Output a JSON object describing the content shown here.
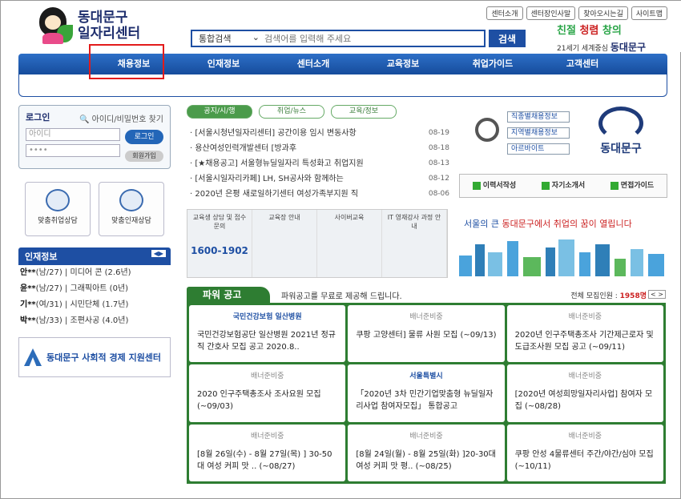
{
  "header": {
    "logo_line1": "동대문구",
    "logo_line2": "일자리센터",
    "search_category": "통합검색",
    "search_placeholder": "검색어를 입력해 주세요",
    "search_button": "검색",
    "top_links": [
      "센터소개",
      "센터장인사말",
      "찾아오시는길",
      "사이트맵"
    ],
    "slogan_a": "친절",
    "slogan_b": "청렴",
    "slogan_c": "창의",
    "slogan_sub": "21세기 세계중심",
    "slogan_name": "동대문구"
  },
  "nav": [
    "채용정보",
    "인재정보",
    "센터소개",
    "교육정보",
    "취업가이드",
    "고객센터"
  ],
  "login": {
    "title": "로그인",
    "find": "아이디/비밀번호 찾기",
    "id_placeholder": "아이디",
    "pw_value": "••••",
    "login_button": "로그인",
    "join_button": "회원가입"
  },
  "quick": [
    "맞춤취업상담",
    "맞춤인재상담"
  ],
  "talent": {
    "title": "인재정보",
    "rows": [
      {
        "name": "안**",
        "info": "(남/27) | 미디어 콘 (2.6년)"
      },
      {
        "name": "윤**",
        "info": "(남/27) | 그래픽아트 (0년)"
      },
      {
        "name": "기**",
        "info": "(여/31) | 시민단체 (1.7년)"
      },
      {
        "name": "박**",
        "info": "(남/33) | 조편사공 (4.0년)"
      }
    ]
  },
  "social_center": "동대문구 사회적 경제 지원센터",
  "tabs": [
    "공지/시/행",
    "취업/뉴스",
    "교육/정보"
  ],
  "news": [
    {
      "title": "[서울시청년일자리센터] 공간이용 임시 변동사항",
      "date": "08-19"
    },
    {
      "title": "용산여성인력개발센터 [방과후",
      "date": "08-18"
    },
    {
      "title": "[★채용공고] 서울형뉴딜일자리 특성화고 취업지원",
      "date": "08-13"
    },
    {
      "title": "[서울시일자리카페] LH, SH공사와 함께하는",
      "date": "08-12"
    },
    {
      "title": "2020년 은평 새로일하기센터 여성가족부지원 직",
      "date": "08-06"
    }
  ],
  "banner_center": {
    "c1_title": "교육생 상담 및 접수문의",
    "phone": "1600-1902",
    "c2_title": "교육장 안내",
    "c3_title": "사이버교육",
    "c4_title": "IT 영재강사 과정 안내"
  },
  "right_links": [
    "직종별채용정보",
    "지역별채용정보",
    "아르바이트"
  ],
  "seal_name": "동대문구",
  "guide": [
    "이력서작성",
    "자기소개서",
    "면접가이드"
  ],
  "tagline_a": "서울의 큰 ",
  "tagline_b": "동대문구에서 취업의 꿈이 열립니다",
  "power": {
    "title": "파워 공고",
    "desc": "파워공고를 무료로 제공해 드립니다.",
    "count_label": "전체 모집인원 : ",
    "count_value": "1958명",
    "nav": "< >",
    "cards": [
      {
        "logo": "국민건강보험 일산병원",
        "title": "국민건강보험공단 일산병원 2021년 정규직 간호사 모집 공고 2020.8.."
      },
      {
        "logo": "배너준비중",
        "title": "쿠팡 고양센터] 물류 사원 모집 (~09/13)"
      },
      {
        "logo": "배너준비중",
        "title": "2020년 인구주택총조사 기간제근로자 및 도급조사원 모집 공고 (~09/11)"
      },
      {
        "logo": "배너준비중",
        "title": "2020 인구주택총조사 조사요원 모집 (~09/03)"
      },
      {
        "logo": "서울특별시",
        "title": "「2020년 3차 민간기업맞춤형 뉴딜일자리사업 참여자모집」 통합공고"
      },
      {
        "logo": "배너준비중",
        "title": "[2020년 여성희망일자리사업] 참여자 모집 (~08/28)"
      },
      {
        "logo": "배너준비중",
        "title": "[8월 26일(수) - 8월 27일(목) ] 30-50대 여성 커피 맛 .. (~08/27)"
      },
      {
        "logo": "배너준비중",
        "title": "[8월 24일(월) - 8월 25일(화) ]20-30대 여성 커피 맛 평.. (~08/25)"
      },
      {
        "logo": "배너준비중",
        "title": "쿠팡 안성 4물류센터 주간/야간/심야 모집 (~10/11)"
      }
    ]
  }
}
